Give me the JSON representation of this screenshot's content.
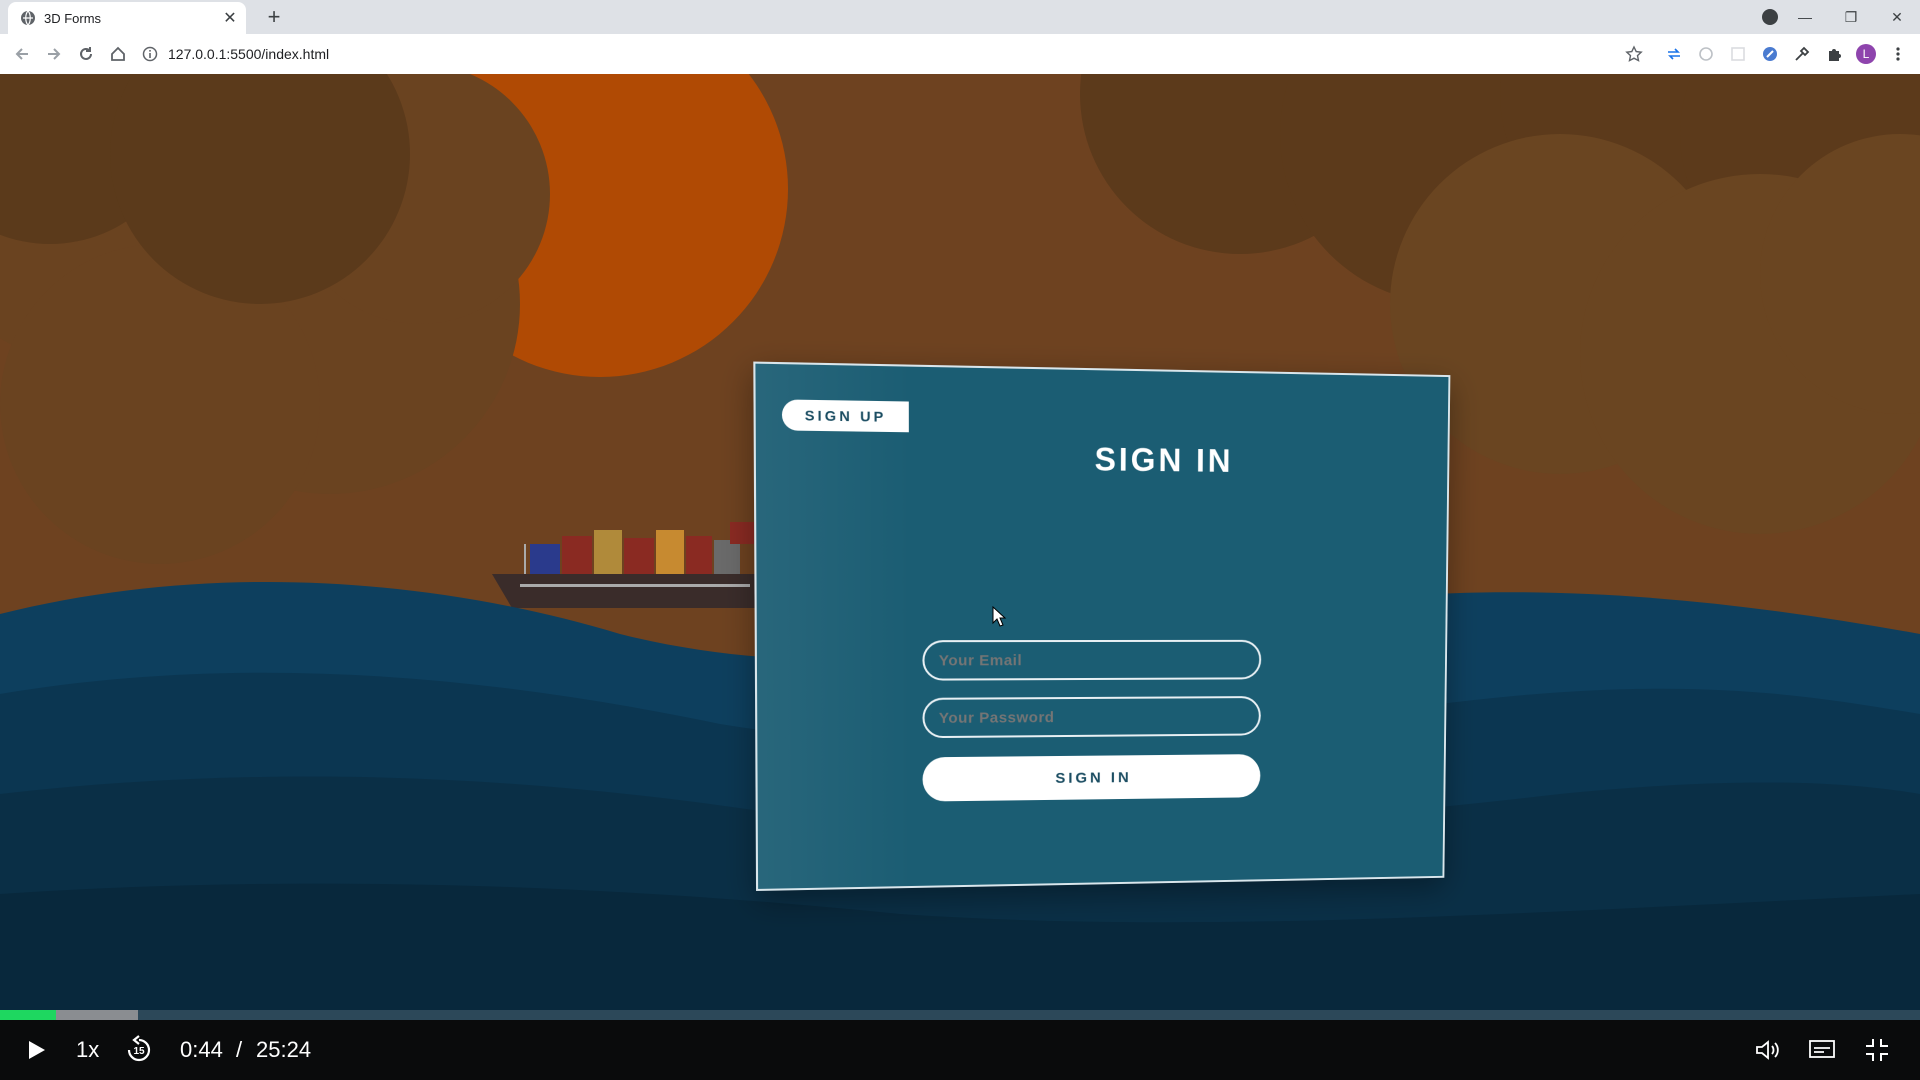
{
  "browser": {
    "tab_title": "3D Forms",
    "url": "127.0.0.1:5500/index.html",
    "profile_initial": "L"
  },
  "form": {
    "signup_toggle": "SIGN UP",
    "title": "SIGN IN",
    "email_placeholder": "Your Email",
    "password_placeholder": "Your Password",
    "submit_label": "SIGN IN"
  },
  "player": {
    "speed": "1x",
    "skip_label": "15",
    "current_time": "0:44",
    "separator": "/",
    "duration": "25:24",
    "played_fraction": 0.029,
    "buffered_fraction": 0.072
  },
  "colors": {
    "card": "#1b5d73",
    "sky": "#6e4220",
    "sun": "#b54f05",
    "sea": "#0c3c5a",
    "progress": "#1ed760"
  }
}
